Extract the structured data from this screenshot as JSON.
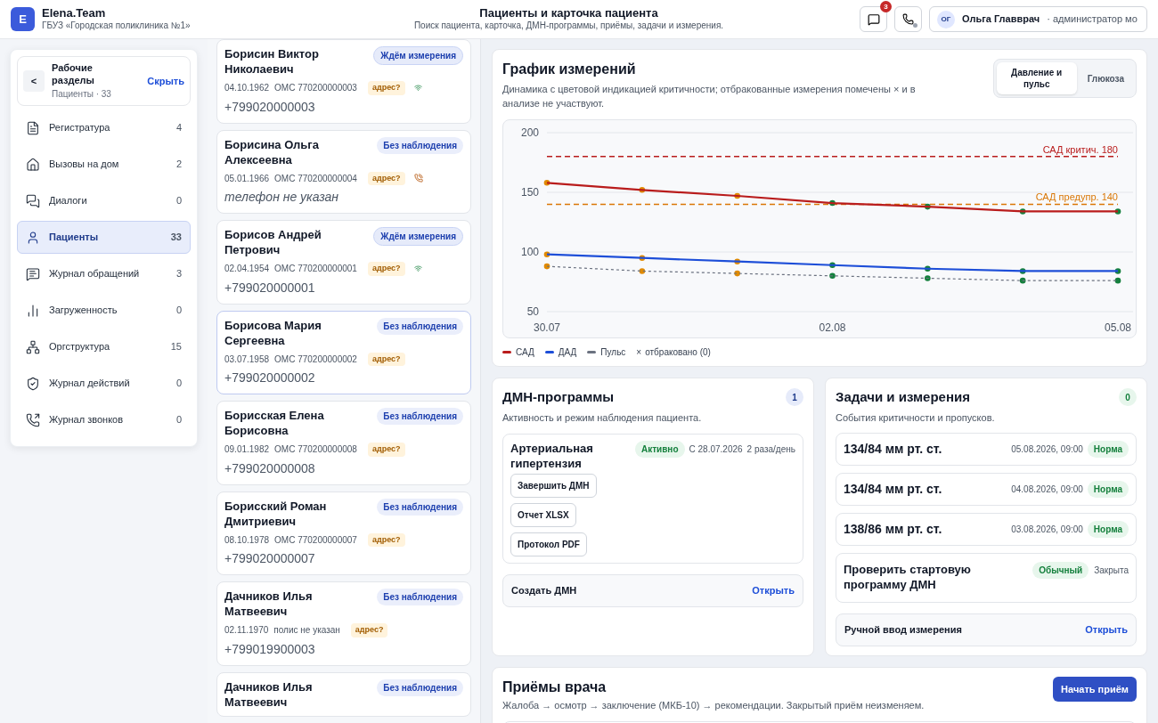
{
  "header": {
    "logo": "E",
    "brand": "Elena.Team",
    "org": "ГБУЗ «Городская поликлиника №1»",
    "title": "Пациенты и карточка пациента",
    "subtitle": "Поиск пациента, карточка, ДМН-программы, приёмы, задачи и измерения.",
    "messages_count": "3",
    "user": {
      "initials": "ОГ",
      "name": "Ольга Главврач",
      "role": "· администратор мо"
    }
  },
  "sidebar": {
    "back": "<",
    "title": "Рабочие разделы",
    "hide": "Скрыть",
    "caption": "Пациенты · 33",
    "items": [
      {
        "label": "Регистратура",
        "count": "4",
        "selected": false
      },
      {
        "label": "Вызовы на дом",
        "count": "2",
        "selected": false
      },
      {
        "label": "Диалоги",
        "count": "0",
        "selected": false
      },
      {
        "label": "Пациенты",
        "count": "33",
        "selected": true
      },
      {
        "label": "Журнал обращений",
        "count": "3",
        "selected": false
      },
      {
        "label": "Загруженность",
        "count": "0",
        "selected": false
      },
      {
        "label": "Оргструктура",
        "count": "15",
        "selected": false
      },
      {
        "label": "Журнал действий",
        "count": "0",
        "selected": false
      },
      {
        "label": "Журнал звонков",
        "count": "0",
        "selected": false
      }
    ]
  },
  "patients": [
    {
      "name": "Борисин Виктор Николаевич",
      "status": {
        "text": "Ждём измерения",
        "kind": "waiting"
      },
      "dob": "04.10.1962",
      "policy": "ОМС 770200000003",
      "tag": "адрес?",
      "device": {
        "kind": "online"
      },
      "phone": "+799020000003",
      "phone_missing": false,
      "selected": false
    },
    {
      "name": "Борисина Ольга Алексеевна",
      "status": {
        "text": "Без наблюдения",
        "kind": "none"
      },
      "dob": "05.01.1966",
      "policy": "ОМС 770200000004",
      "tag": "адрес?",
      "device": {
        "kind": "call"
      },
      "phone": "телефон не указан",
      "phone_missing": true,
      "selected": false
    },
    {
      "name": "Борисов Андрей Петрович",
      "status": {
        "text": "Ждём измерения",
        "kind": "waiting"
      },
      "dob": "02.04.1954",
      "policy": "ОМС 770200000001",
      "tag": "адрес?",
      "device": {
        "kind": "online"
      },
      "phone": "+799020000001",
      "phone_missing": false,
      "selected": false
    },
    {
      "name": "Борисова Мария Сергеевна",
      "status": {
        "text": "Без наблюдения",
        "kind": "none"
      },
      "dob": "03.07.1958",
      "policy": "ОМС 770200000002",
      "tag": "адрес?",
      "phone": "+799020000002",
      "phone_missing": false,
      "selected": true
    },
    {
      "name": "Борисская Елена Борисовна",
      "status": {
        "text": "Без наблюдения",
        "kind": "none"
      },
      "dob": "09.01.1982",
      "policy": "ОМС 770200000008",
      "tag": "адрес?",
      "phone": "+799020000008",
      "phone_missing": false,
      "selected": false
    },
    {
      "name": "Борисский Роман Дмитриевич",
      "status": {
        "text": "Без наблюдения",
        "kind": "none"
      },
      "dob": "08.10.1978",
      "policy": "ОМС 770200000007",
      "tag": "адрес?",
      "phone": "+799020000007",
      "phone_missing": false,
      "selected": false
    },
    {
      "name": "Дачников Илья Матвеевич",
      "status": {
        "text": "Без наблюдения",
        "kind": "none"
      },
      "dob": "02.11.1970",
      "policy": "полис не указан",
      "tag": "адрес?",
      "phone": "+799019900003",
      "phone_missing": false,
      "selected": false
    },
    {
      "name": "Дачников Илья Матвеевич",
      "status": {
        "text": "Без наблюдения",
        "kind": "none"
      },
      "selected": false
    }
  ],
  "chart_card": {
    "title": "График измерений",
    "subtitle": "Динамика с цветовой индикацией критичности; отбракованные измерения помечены × и в анализе не участвуют.",
    "tabs": [
      {
        "label": "Давление и пульс",
        "selected": true
      },
      {
        "label": "Глюкоза",
        "selected": false
      }
    ],
    "chart_data": {
      "type": "line",
      "categories": [
        "30.07",
        null,
        null,
        "02.08",
        null,
        null,
        "05.08"
      ],
      "ylim": [
        50,
        200
      ],
      "yticks": [
        50,
        100,
        150,
        200
      ],
      "series": [
        {
          "name": "САД",
          "color": "#b91c1c",
          "marker": true,
          "values": [
            158,
            152,
            147,
            141,
            138,
            134,
            134
          ]
        },
        {
          "name": "ДАД",
          "color": "#1d4ed8",
          "marker": true,
          "values": [
            98,
            95,
            92,
            89,
            86,
            84,
            84
          ]
        },
        {
          "name": "Пульс",
          "color": "#6b7280",
          "marker": true,
          "line_style": "dashed",
          "values": [
            88,
            84,
            82,
            80,
            78,
            76,
            76
          ]
        }
      ],
      "ref_lines": [
        {
          "axis": "y",
          "value": 180,
          "label": "САД критич. 180",
          "color": "#b91c1c"
        },
        {
          "axis": "y",
          "value": 140,
          "label": "САД предупр. 140",
          "color": "#d97706"
        }
      ]
    },
    "legend_extra": {
      "mark": "×",
      "label": "отбраковано (0)"
    }
  },
  "dmn": {
    "title": "ДМН-программы",
    "count": "1",
    "subtitle": "Активность и режим наблюдения пациента.",
    "programs": [
      {
        "name": "Артериальная гипертензия",
        "status": "Активно",
        "since": "С 28.07.2026",
        "schedule": "2 раза/день",
        "actions": [
          "Завершить ДМН",
          "Отчет XLSX",
          "Протокол PDF"
        ]
      }
    ],
    "create": {
      "label": "Создать ДМН",
      "link": "Открыть"
    }
  },
  "tasks": {
    "title": "Задачи и измерения",
    "count": "0",
    "subtitle": "События критичности и пропусков.",
    "items": [
      {
        "kind": "measurement",
        "text": "134/84 мм рт. ст.",
        "time": "05.08.2026, 09:00",
        "status": "Норма"
      },
      {
        "kind": "measurement",
        "text": "134/84 мм рт. ст.",
        "time": "04.08.2026, 09:00",
        "status": "Норма"
      },
      {
        "kind": "measurement",
        "text": "138/86 мм рт. ст.",
        "time": "03.08.2026, 09:00",
        "status": "Норма"
      },
      {
        "kind": "task",
        "text": "Проверить стартовую программу ДМН",
        "priority": "Обычный",
        "state": "Закрыта"
      }
    ],
    "manual": {
      "label": "Ручной ввод измерения",
      "link": "Открыть"
    }
  },
  "appointments": {
    "title": "Приёмы врача",
    "button": "Начать приём",
    "subtitle": "Жалоба → осмотр → заключение (МКБ-10) → рекомендации. Закрытый приём неизменяем."
  }
}
